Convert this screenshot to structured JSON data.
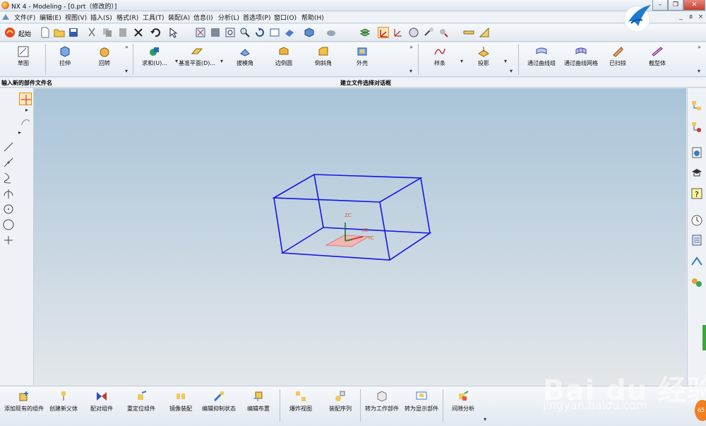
{
  "window": {
    "title": "NX 4 - Modeling - [0.prt（修改的）]",
    "minimize": "–",
    "restore": "❐",
    "close": "✕"
  },
  "menu": [
    "文件(F)",
    "编辑(E)",
    "视图(V)",
    "插入(S)",
    "格式(R)",
    "工具(T)",
    "装配(A)",
    "信息(I)",
    "分析(L)",
    "首选项(P)",
    "窗口(O)",
    "帮助(H)"
  ],
  "mdi_controls": {
    "min": "_",
    "restore": "ฮ",
    "close": "×"
  },
  "toolbar1": {
    "start_label": "起始"
  },
  "toolbar2": {
    "items": [
      {
        "label": "草图",
        "icon": "sketch-icon"
      },
      {
        "label": "拉伸",
        "icon": "extrude-icon"
      },
      {
        "label": "回转",
        "icon": "revolve-icon"
      },
      {
        "label": "求和(U)...",
        "icon": "unite-icon"
      },
      {
        "label": "基准平面(D)...",
        "icon": "datum-plane-icon"
      },
      {
        "label": "拔模角",
        "icon": "draft-icon"
      },
      {
        "label": "边倒圆",
        "icon": "edge-blend-icon"
      },
      {
        "label": "倒斜角",
        "icon": "chamfer-icon"
      },
      {
        "label": "外壳",
        "icon": "shell-icon"
      },
      {
        "label": "样条",
        "icon": "spline-icon"
      },
      {
        "label": "投影",
        "icon": "project-icon"
      },
      {
        "label": "通过曲线组",
        "icon": "through-curves-icon"
      },
      {
        "label": "通过曲线网格",
        "icon": "curve-mesh-icon"
      },
      {
        "label": "已扫掠",
        "icon": "swept-icon"
      },
      {
        "label": "截型体",
        "icon": "section-body-icon"
      }
    ]
  },
  "statusbar": {
    "cue": "输入新的部件文件名",
    "status": "建立文件选择对话框"
  },
  "viewport": {
    "axis_z": "ZC",
    "axis_y": "YC",
    "axis_x": "XC",
    "wire_color": "#1414e6"
  },
  "toolbar3": {
    "items": [
      {
        "label": "添加现有的组件",
        "icon": "add-component-icon"
      },
      {
        "label": "创建新父体",
        "icon": "new-parent-icon"
      },
      {
        "label": "配对组件",
        "icon": "mate-component-icon"
      },
      {
        "label": "重定位组件",
        "icon": "reposition-icon"
      },
      {
        "label": "镜像装配",
        "icon": "mirror-assembly-icon"
      },
      {
        "label": "编辑抑制状态",
        "icon": "suppression-icon"
      },
      {
        "label": "编辑布置",
        "icon": "arrangement-icon"
      },
      {
        "label": "爆炸视图",
        "icon": "exploded-view-icon"
      },
      {
        "label": "装配序列",
        "icon": "sequence-icon"
      },
      {
        "label": "转为工作部件",
        "icon": "work-part-icon"
      },
      {
        "label": "转为显示部件",
        "icon": "displayed-part-icon"
      },
      {
        "label": "间隙分析",
        "icon": "clearance-icon"
      }
    ]
  },
  "watermark": {
    "brand": "Bai du 经验",
    "url": "jingyan.baidu.com"
  },
  "badge": "65"
}
